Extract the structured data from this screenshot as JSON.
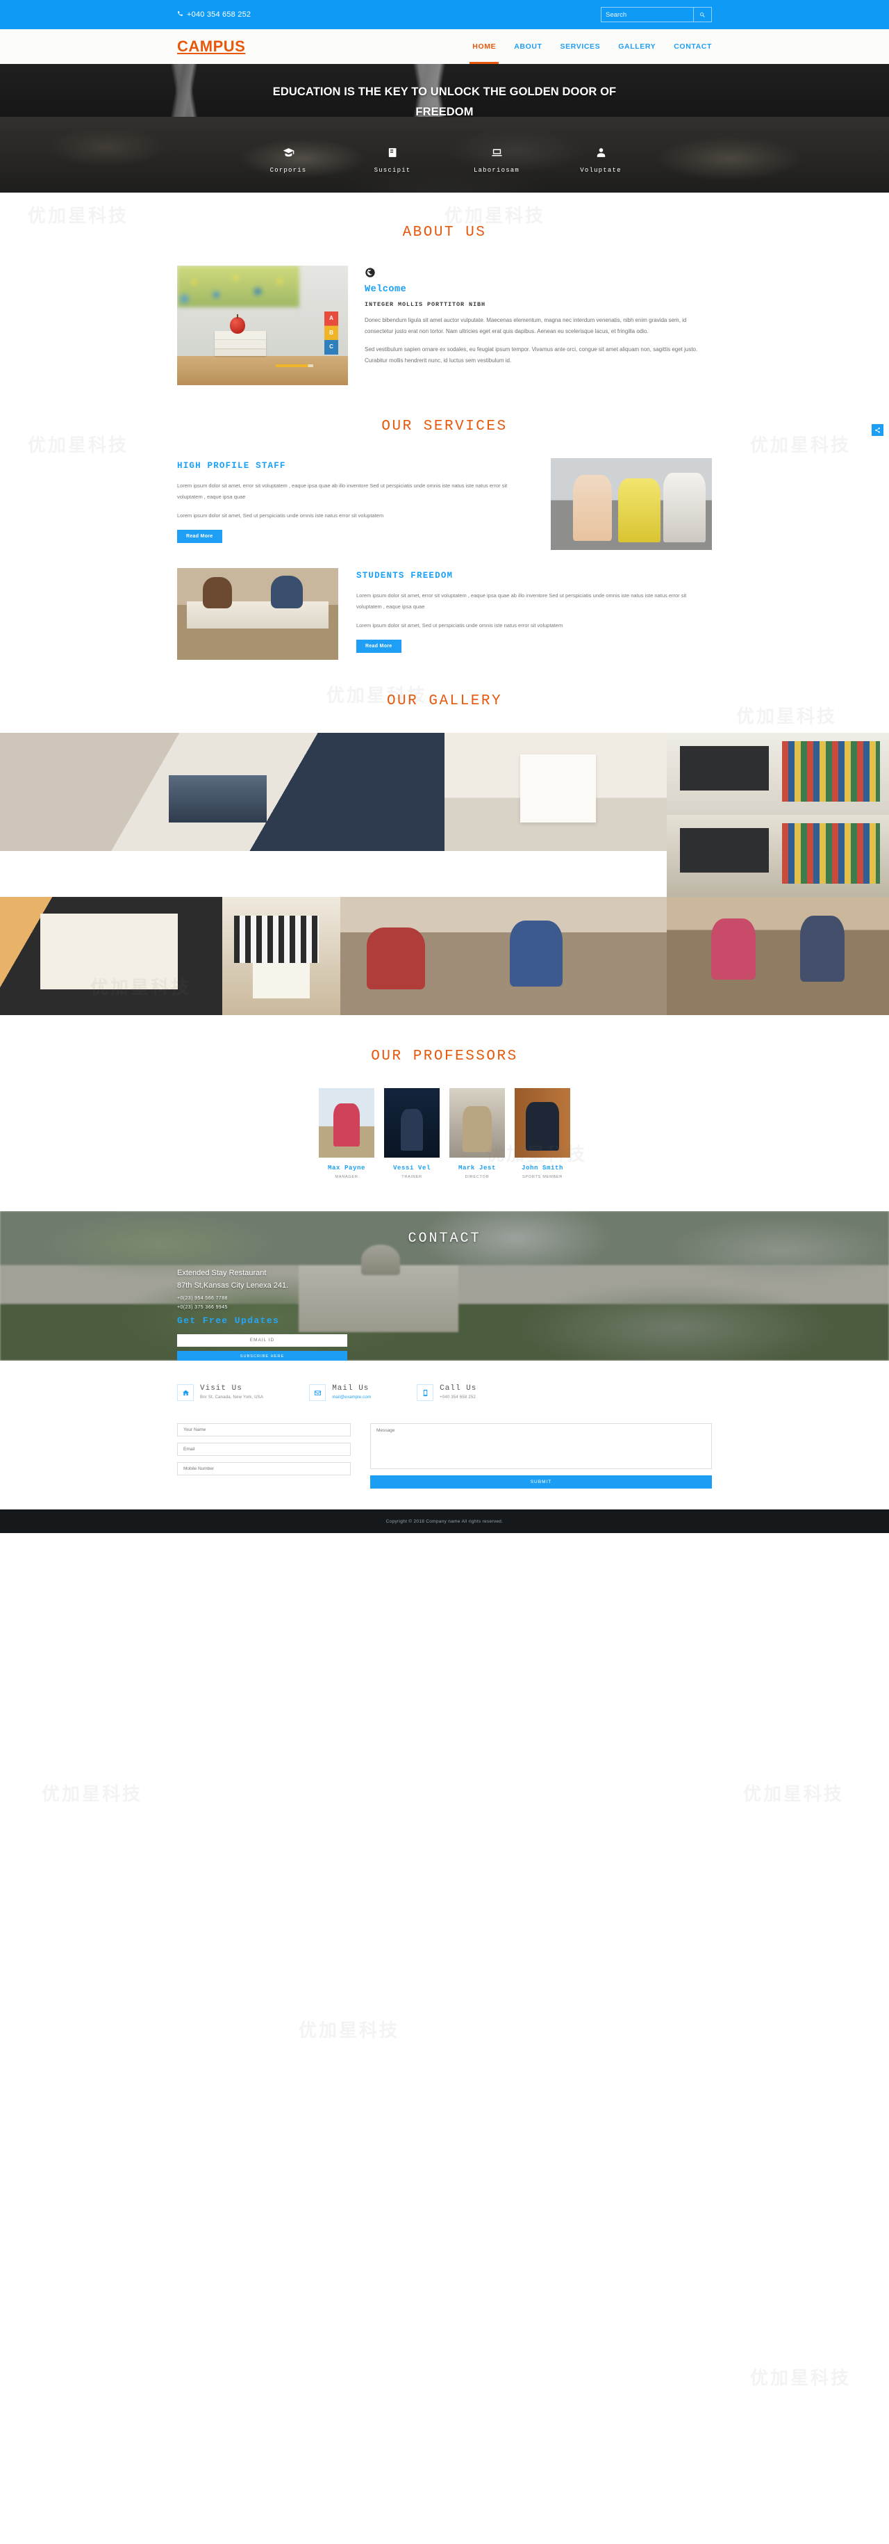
{
  "topbar": {
    "phone": "+040 354 658 252",
    "phone_icon": "phone-icon",
    "search_placeholder": "Search",
    "search_value": "",
    "search_icon": "search-icon"
  },
  "navbar": {
    "logo": "CAMPUS",
    "items": [
      {
        "label": "HOME",
        "active": true
      },
      {
        "label": "ABOUT",
        "active": false
      },
      {
        "label": "SERVICES",
        "active": false
      },
      {
        "label": "GALLERY",
        "active": false
      },
      {
        "label": "CONTACT",
        "active": false
      }
    ]
  },
  "hero": {
    "headline": "EDUCATION IS THE KEY TO UNLOCK THE GOLDEN DOOR OF FREEDOM",
    "features": [
      {
        "label": "Corporis",
        "icon": "graduation-cap-icon"
      },
      {
        "label": "Suscipit",
        "icon": "book-icon"
      },
      {
        "label": "Laboriosam",
        "icon": "laptop-icon"
      },
      {
        "label": "Voluptate",
        "icon": "user-icon"
      }
    ]
  },
  "about": {
    "title": "ABOUT US",
    "icon": "globe-icon",
    "welcome": "Welcome",
    "subheading": "INTEGER MOLLIS PORTTITOR NIBH",
    "paragraphs": [
      "Donec bibendum ligula sit amet auctor vulputate. Maecenas elementum, magna nec interdum venenatis, nibh enim gravida sem, id consectetur justo erat non tortor. Nam ultricies eget erat quis dapibus. Aenean eu scelerisque lacus, et fringilla odio.",
      "Sed vestibulum sapien ornare ex sodales, eu feugiat ipsum tempor. Vivamus ante orci, congue sit amet aliquam non, sagittis eget justo. Curabitur mollis hendrerit nunc, id luctus sem vestibulum id."
    ]
  },
  "services": {
    "title": "OUR SERVICES",
    "blocks": [
      {
        "heading": "HIGH PROFILE STAFF",
        "paragraphs": [
          "Lorem ipsum dolor sit amet, error sit voluptatem , eaque ipsa quae ab illo inventore Sed ut perspiciatis unde omnis iste natus iste natus error sit voluptatem , eaque ipsa quae",
          "Lorem ipsum dolor sit amet, Sed ut perspiciatis unde omnis iste natus error sit voluptatem"
        ],
        "button": "Read More"
      },
      {
        "heading": "STUDENTS FREEDOM",
        "paragraphs": [
          "Lorem ipsum dolor sit amet, error sit voluptatem , eaque ipsa quae ab illo inventore Sed ut perspiciatis unde omnis iste natus iste natus error sit voluptatem , eaque ipsa quae",
          "Lorem ipsum dolor sit amet, Sed ut perspiciatis unde omnis iste natus error sit voluptatem"
        ],
        "button": "Read More"
      }
    ]
  },
  "gallery": {
    "title": "OUR GALLERY",
    "items": [
      {
        "name": "team-collaboration-laptop"
      },
      {
        "name": "hand-writing-notebook"
      },
      {
        "name": "camera-on-bookshelf"
      },
      {
        "name": "colorful-books-shelf"
      },
      {
        "name": "handwritten-notes-chart"
      },
      {
        "name": "woman-reading-magazine"
      },
      {
        "name": "classroom-students-lecture"
      },
      {
        "name": "classroom-teacher-front"
      }
    ]
  },
  "professors": {
    "title": "OUR PROFESSORS",
    "people": [
      {
        "name": "Max Payne",
        "role": "MANAGER"
      },
      {
        "name": "Vessi Vel",
        "role": "TRAINER"
      },
      {
        "name": "Mark Jest",
        "role": "DIRECTOR"
      },
      {
        "name": "John Smith",
        "role": "SPORTS MEMBER"
      }
    ]
  },
  "contact": {
    "title": "CONTACT",
    "address_line1": "Extended Stay Restaurant",
    "address_line2": "87th St,Kansas City Lenexa 241.",
    "phone1": "+0(23) 954 566 7788",
    "phone2": "+0(23) 375 366 9945",
    "newsletter_heading": "Get Free Updates",
    "email_placeholder": "EMAIL ID",
    "email_value": "",
    "subscribe_button": "SUBSCRIBE HERE"
  },
  "footer": {
    "cards": [
      {
        "icon": "home-icon",
        "title": "Visit Us",
        "text": "Bnr St, Canada, New York, USA",
        "is_mail": false
      },
      {
        "icon": "mail-icon",
        "title": "Mail Us",
        "text": "mail@example.com",
        "is_mail": true
      },
      {
        "icon": "mobile-icon",
        "title": "Call Us",
        "text": "+040 354 658 252",
        "is_mail": false
      }
    ],
    "form": {
      "name_placeholder": "Your Name",
      "name_value": "",
      "email_placeholder": "Email",
      "email_value": "",
      "mobile_placeholder": "Mobile Number",
      "mobile_value": "",
      "message_placeholder": "Message",
      "message_value": "",
      "submit_label": "SUBMIT"
    },
    "copyright": "Copyright © 2018 Company name All rights reserved."
  },
  "side_float": {
    "icon": "share-icon"
  },
  "watermark": {
    "text": "优加星科技"
  },
  "colors": {
    "brand_orange": "#e8580c",
    "accent_blue": "#1b9ef3",
    "topbar_blue": "#0f9bf5",
    "dark_footer": "#16191c"
  }
}
